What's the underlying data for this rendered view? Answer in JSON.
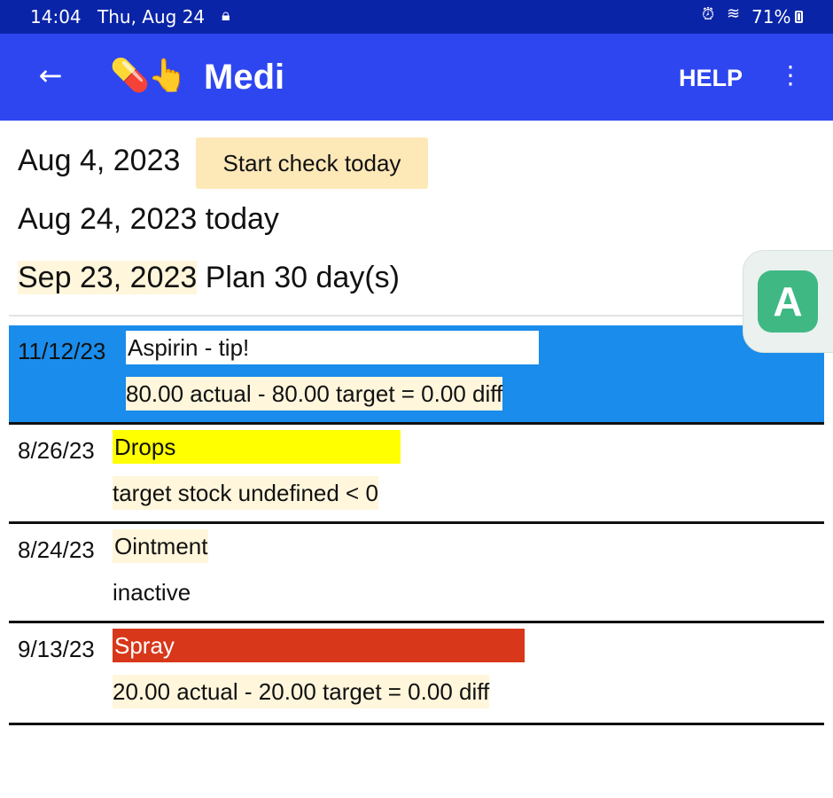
{
  "status_bar": {
    "time": "14:04",
    "date": "Thu, Aug 24",
    "battery": "71%",
    "icons": [
      "lock-icon",
      "alarm-icon",
      "wifi-icon",
      "battery-icon"
    ]
  },
  "app_bar": {
    "title": "Medi",
    "logo": "💊👆",
    "help_label": "HELP",
    "back_glyph": "←",
    "more_glyph": "⋮",
    "background": "#2e46f0"
  },
  "dates": {
    "start": "Aug 4, 2023",
    "start_button": "Start check today",
    "today": "Aug 24, 2023 today",
    "plan_date": "Sep 23, 2023",
    "plan_text": " Plan 30 day(s)"
  },
  "medications": [
    {
      "date": "11/12/23",
      "name": "Aspirin - tip!",
      "detail": "80.00 actual - 80.00 target = 0.00 diff",
      "highlight": "#1a8ceb"
    },
    {
      "date": "8/26/23",
      "name": "Drops",
      "detail": "target stock undefined < 0",
      "highlight": "#ffff00"
    },
    {
      "date": "8/24/23",
      "name": "Ointment",
      "detail": "inactive",
      "highlight": "#fff6dc"
    },
    {
      "date": "9/13/23",
      "name": "Spray",
      "detail": "20.00 actual - 20.00 target = 0.00 diff",
      "highlight": "#d8371a"
    }
  ]
}
